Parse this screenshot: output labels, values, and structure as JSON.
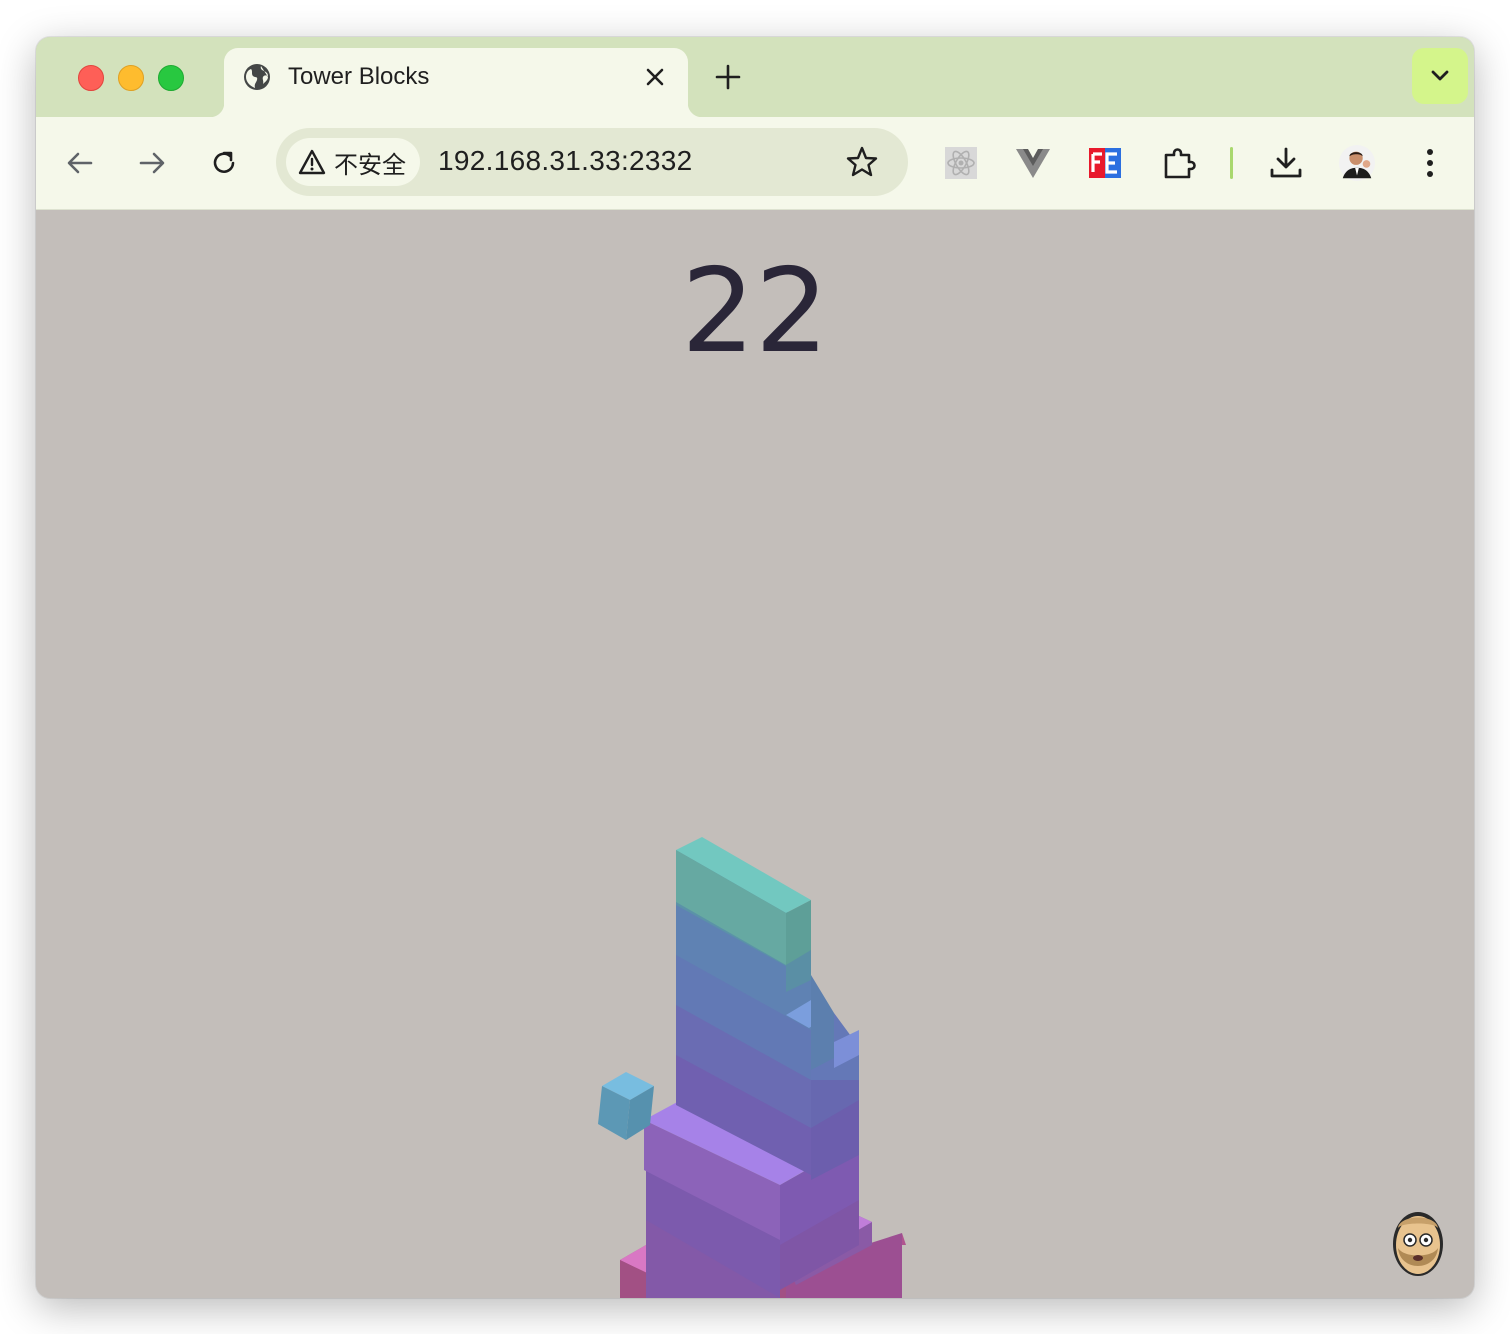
{
  "browser": {
    "tab": {
      "title": "Tower Blocks"
    },
    "address_bar": {
      "security_label": "不安全",
      "url": "192.168.31.33:2332"
    },
    "extensions": [
      "react-devtools-icon",
      "vue-devtools-icon",
      "fe-helper-icon",
      "extensions-puzzle-icon"
    ],
    "accent_colors": {
      "tabbar": "#d3e2bc",
      "toolbar": "#f5f8ea",
      "tab_menu": "#d4f58b"
    }
  },
  "game": {
    "score": "22",
    "background_color": "#c3beba",
    "score_color": "#2a2638"
  }
}
